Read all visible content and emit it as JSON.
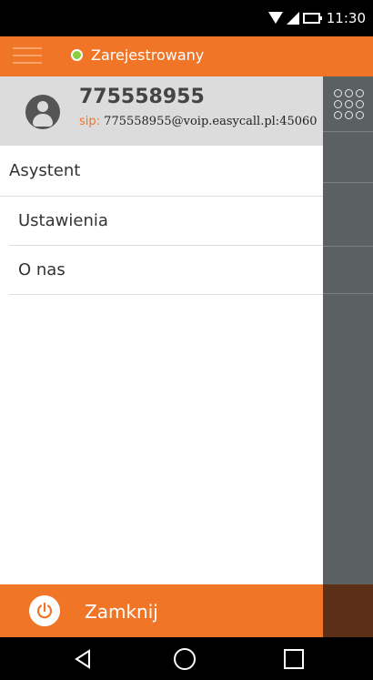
{
  "status_bar": {
    "time": "11:30"
  },
  "app_bar": {
    "registration_status": "Zarejestrowany",
    "status_color": "#8bd03a"
  },
  "profile": {
    "number": "775558955",
    "sip_label": "sip:",
    "sip_address": "775558955@voip.easycall.pl:45060"
  },
  "menu": {
    "items": [
      {
        "label": "Asystent"
      },
      {
        "label": "Ustawienia"
      },
      {
        "label": "O nas"
      }
    ]
  },
  "footer": {
    "close_label": "Zamknij"
  },
  "colors": {
    "accent": "#f07526",
    "panel": "#5b6062"
  },
  "icons": [
    "wifi-icon",
    "signal-icon",
    "battery-icon",
    "hamburger-icon",
    "dialpad-icon",
    "avatar-icon",
    "power-icon",
    "back-icon",
    "home-icon",
    "recents-icon"
  ]
}
